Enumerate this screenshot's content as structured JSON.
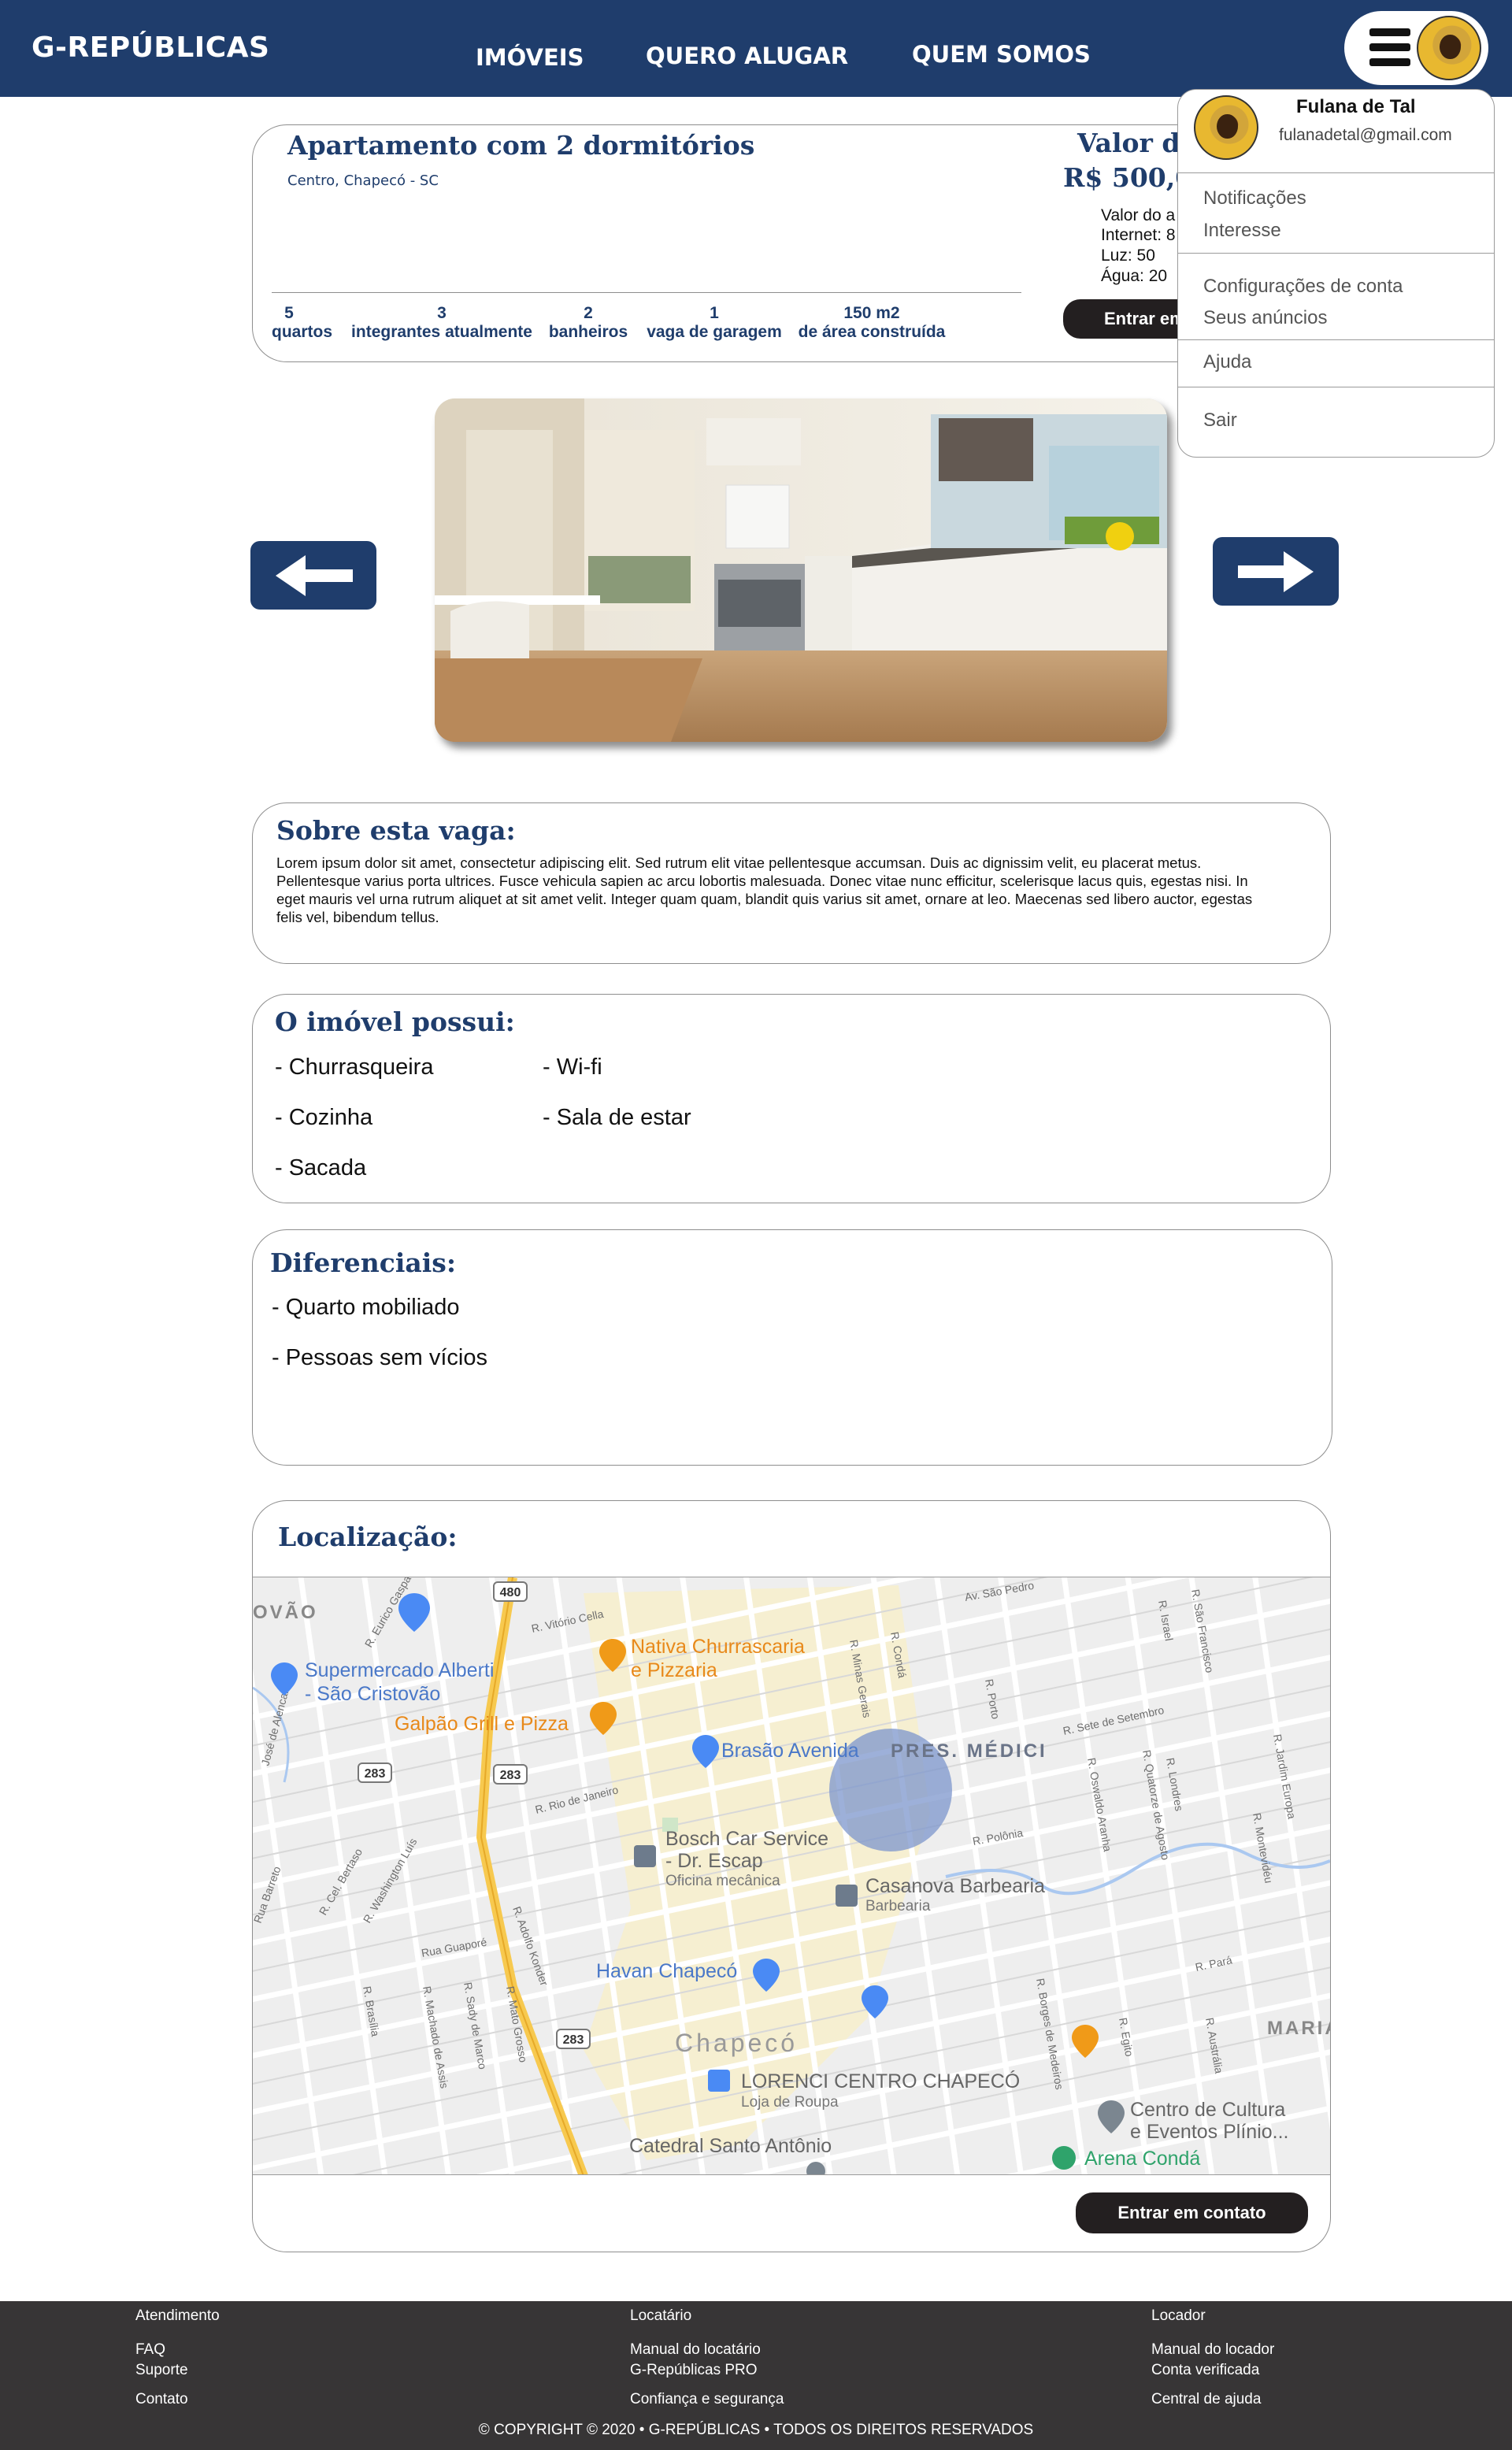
{
  "header": {
    "logo": "G-REPÚBLICAS",
    "nav": [
      "IMÓVEIS",
      "QUERO ALUGAR",
      "QUEM SOMOS"
    ]
  },
  "profile_menu": {
    "name": "Fulana de Tal",
    "email": "fulanadetal@gmail.com",
    "items": [
      "Notificações",
      "Interesse",
      "Configurações de conta",
      "Seus anúncios",
      "Ajuda",
      "Sair"
    ]
  },
  "listing": {
    "title": "Apartamento com 2 dormitórios",
    "location": "Centro, Chapecó - SC",
    "stats": [
      {
        "value": "5",
        "label": "quartos"
      },
      {
        "value": "3",
        "label": "integrantes atualmente"
      },
      {
        "value": "2",
        "label": "banheiros"
      },
      {
        "value": "1",
        "label": "vaga de garagem"
      },
      {
        "value": "150 m2",
        "label": "de área construída"
      }
    ],
    "price_label": "Valor de",
    "price_value": "R$ 500,0",
    "price_details": [
      "Valor do a",
      "Internet: 8",
      "Luz: 50",
      "Água: 20"
    ],
    "contact_button": "Entrar em"
  },
  "about": {
    "title": "Sobre esta vaga:",
    "text": "Lorem ipsum dolor sit amet, consectetur adipiscing elit. Sed rutrum elit vitae pellentesque accumsan. Duis ac dignissim velit, eu placerat metus. Pellentesque varius porta ultrices. Fusce vehicula sapien ac arcu lobortis malesuada. Donec vitae nunc efficitur, scelerisque lacus quis, egestas nisi. In eget mauris vel urna rutrum aliquet at sit amet velit. Integer quam quam, blandit quis varius sit amet, ornare at leo. Maecenas sed libero auctor, egestas felis vel, bibendum tellus."
  },
  "features": {
    "title": "O imóvel possui:",
    "items": [
      "- Churrasqueira",
      "- Wi-fi",
      "- Cozinha",
      "- Sala de estar",
      "- Sacada"
    ]
  },
  "differentials": {
    "title": "Diferenciais:",
    "items": [
      "- Quarto mobiliado",
      "- Pessoas sem vícios"
    ]
  },
  "location": {
    "title": "Localização:",
    "contact_button": "Entrar em contato",
    "map_labels": {
      "district_top_left": "OVÃO",
      "supermarket": "Supermercado Alberti",
      "supermarket2": "- São Cristovão",
      "galpao": "Galpão Grill e Pizza",
      "nativa": "Nativa Churrascaria",
      "nativa2": "e Pizzaria",
      "brasao": "Brasão Avenida",
      "pres_medici": "PRES. MÉDICI",
      "bosch": "Bosch Car Service",
      "bosch2": "- Dr. Escap",
      "bosch3": "Oficina mecânica",
      "casanova": "Casanova Barbearia",
      "casanova2": "Barbearia",
      "havan": "Havan Chapecó",
      "chapeco": "Chapecó",
      "lorenci": "LORENCI CENTRO CHAPECÓ",
      "lorenci2": "Loja de Roupa",
      "catedral": "Catedral Santo Antônio",
      "centro_cultura": "Centro de Cultura",
      "centro_cultura2": "e Eventos Plínio...",
      "arena": "Arena Condá",
      "maria": "MARIA",
      "route_480": "480",
      "route_283a": "283",
      "route_283b": "283",
      "route_283c": "283",
      "streets": [
        "Av. São Pedro",
        "R. Vitório Cella",
        "R. Rio de Janeiro",
        "R. Sete de Setembro",
        "R. Polônia",
        "Rua Guaporé",
        "R. Pará",
        "R. Minas Gerais",
        "R. Condá",
        "R. Porto",
        "R. Israel",
        "R. São Francisco",
        "R. Quatorze de Agosto",
        "R. Oswaldo Aranha",
        "R. Londres",
        "R. Jardim Europa",
        "R. Montevidéu",
        "R. Borges de Medeiros",
        "R. Egito",
        "R. Austrália",
        "R. Mato Grosso",
        "R. Sady de Marco",
        "R. Machado de Assis",
        "R. Brasília",
        "R. Adolfo Konder",
        "R. Washington Luís",
        "R. Cel. Bertaso",
        "Rua Barreto",
        "José de Alencar",
        "R. Eurico Gaspar"
      ]
    }
  },
  "footer": {
    "col1_title": "Atendimento",
    "col1": [
      "FAQ",
      "Suporte",
      "Contato"
    ],
    "col2_title": "Locatário",
    "col2": [
      "Manual do locatário",
      "G-Repúblicas PRO",
      "Confiança e segurança"
    ],
    "col3_title": "Locador",
    "col3": [
      "Manual do locador",
      "Conta verificada",
      "Central de ajuda"
    ],
    "copyright": "© COPYRIGHT © 2020 • G-REPÚBLICAS • TODOS OS DIREITOS RESERVADOS"
  },
  "colors": {
    "brand": "#1f3d6c",
    "dark_button": "#231f20",
    "footer": "#373536"
  }
}
